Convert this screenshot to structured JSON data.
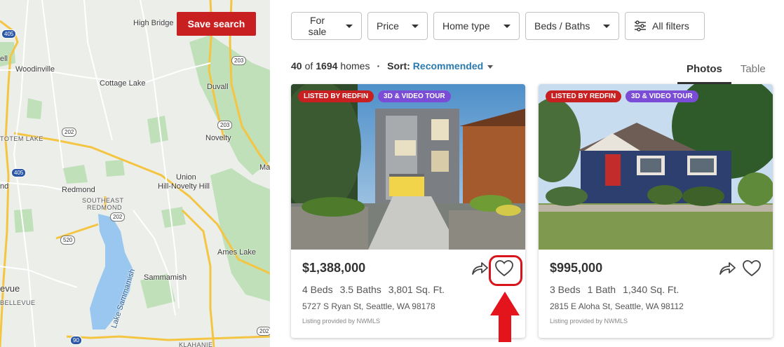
{
  "map": {
    "save_search": "Save search",
    "labels": {
      "high_bridge": "High Bridge",
      "woodinville": "Woodinville",
      "cottage_lake": "Cottage Lake",
      "duvall": "Duvall",
      "totem_lake": "TOTEM LAKE",
      "novelty": "Novelty",
      "union_hill": "Union",
      "union_hill2": "Hill-Novelty Hill",
      "redmond": "Redmond",
      "se_redmond1": "SOUTHEAST",
      "se_redmond2": "REDMOND",
      "ames_lake": "Ames Lake",
      "sammamish": "Sammamish",
      "lake_sammamish": "Lake Sammamish",
      "bellevue": "evue",
      "bellevue_small": "BELLEVUE",
      "ell": "ell",
      "nd": "nd",
      "ma": "Ma",
      "klahanie": "KLAHANIE"
    },
    "shields": {
      "s405a": "405",
      "s405b": "405",
      "s203a": "203",
      "s203b": "203",
      "s202a": "202",
      "s202b": "202",
      "s520": "520",
      "s202c": "202",
      "s90": "90"
    }
  },
  "filters": {
    "for_sale": "For sale",
    "price": "Price",
    "home_type": "Home type",
    "beds_baths": "Beds / Baths",
    "all_filters": "All filters"
  },
  "results": {
    "shown": "40",
    "of": "of",
    "total": "1694",
    "homes": "homes",
    "sort_label": "Sort:",
    "sort_value": "Recommended"
  },
  "view_tabs": {
    "photos": "Photos",
    "table": "Table"
  },
  "listings": [
    {
      "badge1": "LISTED BY REDFIN",
      "badge2": "3D & VIDEO TOUR",
      "price": "$1,388,000",
      "beds": "4 Beds",
      "baths": "3.5 Baths",
      "sqft": "3,801 Sq. Ft.",
      "address": "5727 S Ryan St, Seattle, WA 98178",
      "provider": "Listing provided by NWMLS"
    },
    {
      "badge1": "LISTED BY REDFIN",
      "badge2": "3D & VIDEO TOUR",
      "price": "$995,000",
      "beds": "3 Beds",
      "baths": "1 Bath",
      "sqft": "1,340 Sq. Ft.",
      "address": "2815 E Aloha St, Seattle, WA 98112",
      "provider": "Listing provided by NWMLS"
    }
  ],
  "colors": {
    "brand_red": "#c82021",
    "badge_purple": "#7b4cd6",
    "link_blue": "#2a7ab0",
    "highlight_red": "#d8141c"
  },
  "icons": [
    "share-icon",
    "heart-icon",
    "filter-sliders-icon",
    "chevron-down-icon",
    "red-arrow-up-icon"
  ]
}
